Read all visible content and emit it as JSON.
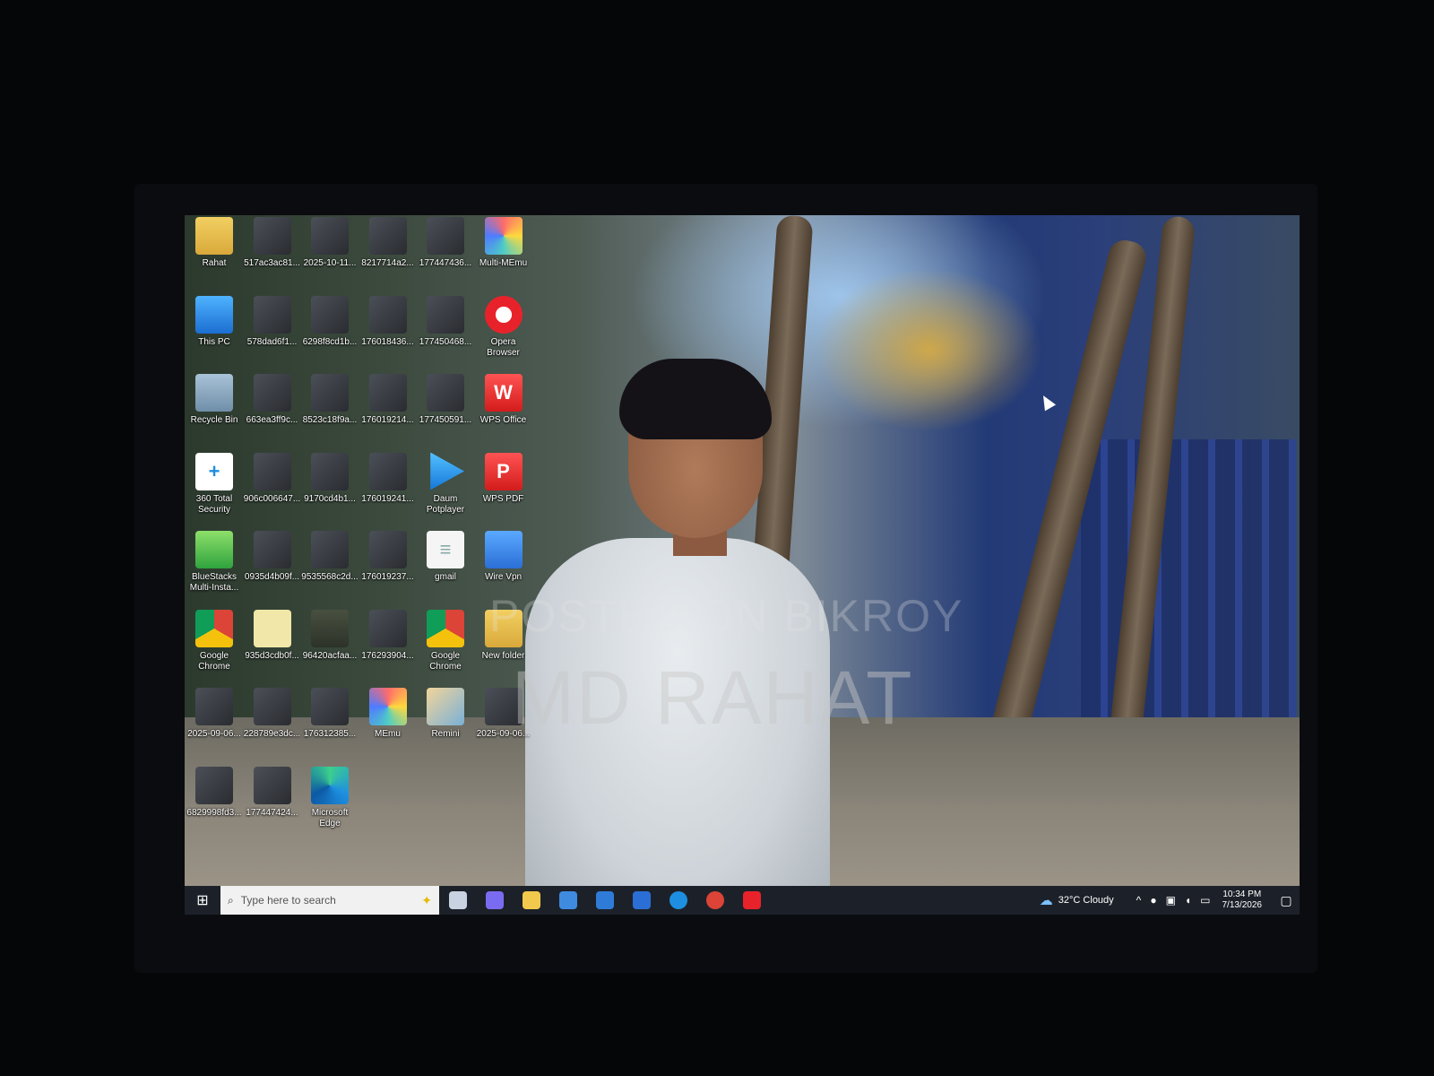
{
  "watermark": {
    "top": "POSTED ON BIKROY",
    "main": "MD RAHAT"
  },
  "desktop_icons": [
    {
      "label": "Rahat",
      "icon": "folder-icon"
    },
    {
      "label": "517ac3ac81...",
      "icon": "image-icon"
    },
    {
      "label": "2025-10-11...",
      "icon": "image-icon"
    },
    {
      "label": "8217714a2...",
      "icon": "image-icon"
    },
    {
      "label": "177447436...",
      "icon": "image-icon"
    },
    {
      "label": "Multi-MEmu",
      "icon": "multi-memu-icon"
    },
    {
      "label": "This PC",
      "icon": "computer-icon"
    },
    {
      "label": "578dad6f1...",
      "icon": "image-icon"
    },
    {
      "label": "6298f8cd1b...",
      "icon": "image-icon"
    },
    {
      "label": "176018436...",
      "icon": "image-icon"
    },
    {
      "label": "177450468...",
      "icon": "image-icon"
    },
    {
      "label": "Opera Browser",
      "icon": "opera-icon"
    },
    {
      "label": "Recycle Bin",
      "icon": "recycle-bin-icon"
    },
    {
      "label": "663ea3ff9c...",
      "icon": "image-icon"
    },
    {
      "label": "8523c18f9a...",
      "icon": "image-icon"
    },
    {
      "label": "176019214...",
      "icon": "image-icon"
    },
    {
      "label": "177450591...",
      "icon": "image-icon"
    },
    {
      "label": "WPS Office",
      "icon": "wps-office-icon"
    },
    {
      "label": "360 Total Security",
      "icon": "shield-plus-icon"
    },
    {
      "label": "906c006647...",
      "icon": "image-icon"
    },
    {
      "label": "9170cd4b1...",
      "icon": "image-icon"
    },
    {
      "label": "176019241...",
      "icon": "image-icon"
    },
    {
      "label": "Daum Potplayer",
      "icon": "play-icon"
    },
    {
      "label": "WPS PDF",
      "icon": "pdf-icon"
    },
    {
      "label": "BlueStacks Multi-Insta...",
      "icon": "bluestacks-icon"
    },
    {
      "label": "0935d4b09f...",
      "icon": "image-icon"
    },
    {
      "label": "9535568c2d...",
      "icon": "image-icon"
    },
    {
      "label": "176019237...",
      "icon": "image-icon"
    },
    {
      "label": "gmail",
      "icon": "document-icon"
    },
    {
      "label": "Wire Vpn",
      "icon": "vpn-icon"
    },
    {
      "label": "Google Chrome",
      "icon": "chrome-icon"
    },
    {
      "label": "935d3cdb0f...",
      "icon": "note-icon"
    },
    {
      "label": "96420acfaa...",
      "icon": "video-icon"
    },
    {
      "label": "176293904...",
      "icon": "image-icon"
    },
    {
      "label": "Google Chrome",
      "icon": "chrome-icon"
    },
    {
      "label": "New folder",
      "icon": "folder-icon"
    },
    {
      "label": "2025-09-06...",
      "icon": "image-icon"
    },
    {
      "label": "228789e3dc...",
      "icon": "image-icon"
    },
    {
      "label": "176312385...",
      "icon": "image-icon"
    },
    {
      "label": "MEmu",
      "icon": "memu-icon"
    },
    {
      "label": "Remini",
      "icon": "remini-icon"
    },
    {
      "label": "2025-09-06...",
      "icon": "image-icon"
    },
    {
      "label": "6829998fd3...",
      "icon": "image-icon"
    },
    {
      "label": "177447424...",
      "icon": "image-icon"
    },
    {
      "label": "Microsoft Edge",
      "icon": "edge-icon"
    }
  ],
  "taskbar": {
    "search_placeholder": "Type here to search",
    "pinned": [
      {
        "name": "task-view-icon",
        "color": "#c8d2e0"
      },
      {
        "name": "copilot-icon",
        "color": "#7a6cf0"
      },
      {
        "name": "file-explorer-icon",
        "color": "#f2c94c"
      },
      {
        "name": "microsoft-store-icon",
        "color": "#3f8be0"
      },
      {
        "name": "mail-icon",
        "color": "#2f7bd8"
      },
      {
        "name": "widgets-icon",
        "color": "#2b6fd6"
      },
      {
        "name": "edge-icon",
        "color": "#1e8fe0"
      },
      {
        "name": "chrome-icon",
        "color": "#db4437"
      },
      {
        "name": "wps-office-icon",
        "color": "#e8222b"
      }
    ],
    "weather": "32°C Cloudy",
    "time": "10:34 PM",
    "date": "7/13/2026"
  }
}
